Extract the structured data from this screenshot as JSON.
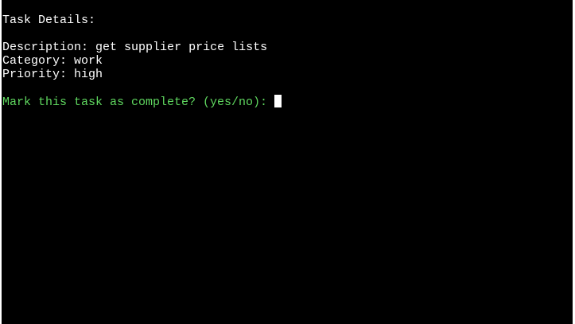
{
  "terminal": {
    "heading": "Task Details:",
    "description_label": "Description:",
    "description_value": "get supplier price lists",
    "category_label": "Category:",
    "category_value": "work",
    "priority_label": "Priority:",
    "priority_value": "high",
    "prompt": "Mark this task as complete? (yes/no):",
    "input_value": ""
  },
  "colors": {
    "background": "#000000",
    "text": "#ffffff",
    "prompt": "#5fd75f"
  }
}
